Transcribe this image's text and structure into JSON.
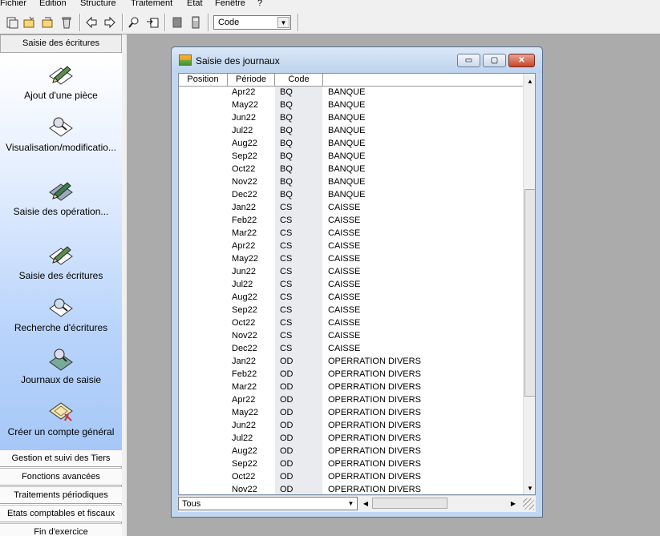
{
  "menu": [
    "Fichier",
    "Edition",
    "Structure",
    "Traitement",
    "Etat",
    "Fenêtre",
    "?"
  ],
  "toolbar": {
    "buttons": [
      "new-doc-icon",
      "new-folder-icon",
      "open-icon",
      "recycle-icon",
      "back-arrow-icon",
      "forward-arrow-icon",
      "search-icon",
      "goto-icon",
      "book-icon",
      "calculator-icon"
    ],
    "code_select": "Code"
  },
  "left_panel": {
    "header": "Saisie des écritures",
    "tasks": [
      {
        "label": "Ajout d'une pièce",
        "icon": "pen-add-icon"
      },
      {
        "label": "Visualisation/modificatio...",
        "icon": "magnifier-view-icon"
      },
      {
        "label": "Saisie des opération...",
        "icon": "pen-operation-icon"
      },
      {
        "label": "Saisie des écritures",
        "icon": "pen-entry-icon"
      },
      {
        "label": "Recherche d'écritures",
        "icon": "search-entries-icon"
      },
      {
        "label": "Journaux de saisie",
        "icon": "journal-icon"
      },
      {
        "label": "Créer un compte général",
        "icon": "account-icon"
      }
    ],
    "sections": [
      "Gestion et suivi des Tiers",
      "Fonctions avancées",
      "Traitements périodiques",
      "Etats comptables et fiscaux",
      "Fin d'exercice"
    ]
  },
  "window": {
    "title": "Saisie des journaux",
    "minimize": "▭",
    "maximize": "▢",
    "close": "✕",
    "columns": [
      "Position",
      "Période",
      "Code",
      ""
    ],
    "rows": [
      {
        "periode": "Apr22",
        "code": "BQ",
        "libelle": "BANQUE"
      },
      {
        "periode": "May22",
        "code": "BQ",
        "libelle": "BANQUE"
      },
      {
        "periode": "Jun22",
        "code": "BQ",
        "libelle": "BANQUE"
      },
      {
        "periode": "Jul22",
        "code": "BQ",
        "libelle": "BANQUE"
      },
      {
        "periode": "Aug22",
        "code": "BQ",
        "libelle": "BANQUE"
      },
      {
        "periode": "Sep22",
        "code": "BQ",
        "libelle": "BANQUE"
      },
      {
        "periode": "Oct22",
        "code": "BQ",
        "libelle": "BANQUE"
      },
      {
        "periode": "Nov22",
        "code": "BQ",
        "libelle": "BANQUE"
      },
      {
        "periode": "Dec22",
        "code": "BQ",
        "libelle": "BANQUE"
      },
      {
        "periode": "Jan22",
        "code": "CS",
        "libelle": "CAISSE"
      },
      {
        "periode": "Feb22",
        "code": "CS",
        "libelle": "CAISSE"
      },
      {
        "periode": "Mar22",
        "code": "CS",
        "libelle": "CAISSE"
      },
      {
        "periode": "Apr22",
        "code": "CS",
        "libelle": "CAISSE"
      },
      {
        "periode": "May22",
        "code": "CS",
        "libelle": "CAISSE"
      },
      {
        "periode": "Jun22",
        "code": "CS",
        "libelle": "CAISSE"
      },
      {
        "periode": "Jul22",
        "code": "CS",
        "libelle": "CAISSE"
      },
      {
        "periode": "Aug22",
        "code": "CS",
        "libelle": "CAISSE"
      },
      {
        "periode": "Sep22",
        "code": "CS",
        "libelle": "CAISSE"
      },
      {
        "periode": "Oct22",
        "code": "CS",
        "libelle": "CAISSE"
      },
      {
        "periode": "Nov22",
        "code": "CS",
        "libelle": "CAISSE"
      },
      {
        "periode": "Dec22",
        "code": "CS",
        "libelle": "CAISSE"
      },
      {
        "periode": "Jan22",
        "code": "OD",
        "libelle": "OPERRATION DIVERS"
      },
      {
        "periode": "Feb22",
        "code": "OD",
        "libelle": "OPERRATION DIVERS"
      },
      {
        "periode": "Mar22",
        "code": "OD",
        "libelle": "OPERRATION DIVERS"
      },
      {
        "periode": "Apr22",
        "code": "OD",
        "libelle": "OPERRATION DIVERS"
      },
      {
        "periode": "May22",
        "code": "OD",
        "libelle": "OPERRATION DIVERS"
      },
      {
        "periode": "Jun22",
        "code": "OD",
        "libelle": "OPERRATION DIVERS"
      },
      {
        "periode": "Jul22",
        "code": "OD",
        "libelle": "OPERRATION DIVERS"
      },
      {
        "periode": "Aug22",
        "code": "OD",
        "libelle": "OPERRATION DIVERS"
      },
      {
        "periode": "Sep22",
        "code": "OD",
        "libelle": "OPERRATION DIVERS"
      },
      {
        "periode": "Oct22",
        "code": "OD",
        "libelle": "OPERRATION DIVERS"
      },
      {
        "periode": "Nov22",
        "code": "OD",
        "libelle": "OPERRATION DIVERS"
      }
    ],
    "filter": "Tous"
  }
}
